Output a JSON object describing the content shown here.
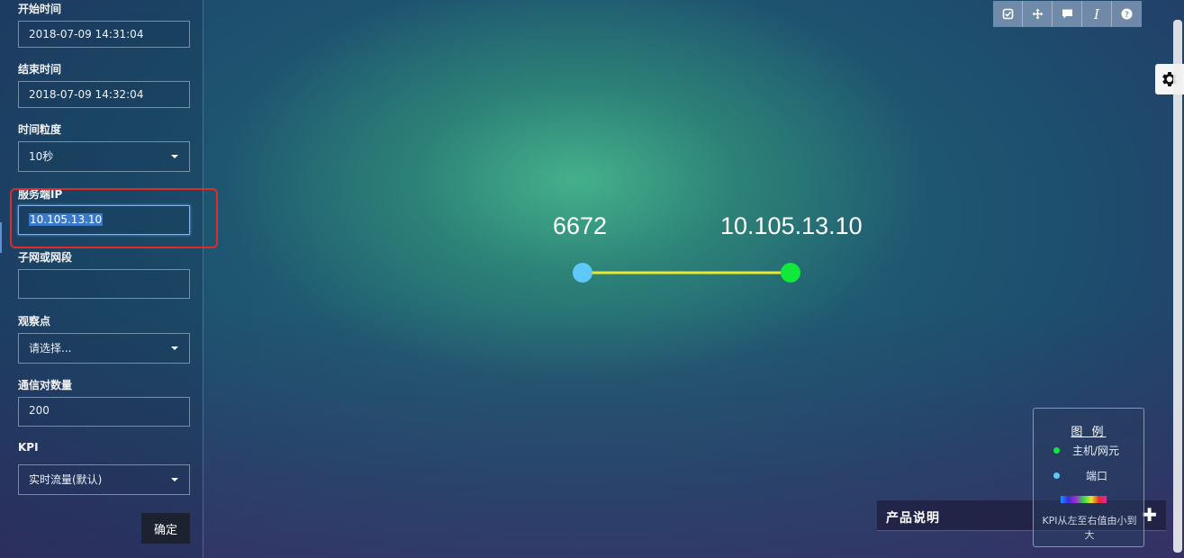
{
  "form": {
    "start_time_label": "开始时间",
    "start_time_value": "2018-07-09 14:31:04",
    "end_time_label": "结束时间",
    "end_time_value": "2018-07-09 14:32:04",
    "granularity_label": "时间粒度",
    "granularity_value": "10秒",
    "server_ip_label": "服务端IP",
    "server_ip_value": "10.105.13.10",
    "subnet_label": "子网或网段",
    "subnet_value": "",
    "observation_label": "观察点",
    "observation_value": "请选择...",
    "pair_count_label": "通信对数量",
    "pair_count_value": "200",
    "kpi_label": "KPI",
    "kpi_value": "实时流量(默认)",
    "confirm_label": "确定"
  },
  "toolbar": {
    "icons": [
      "check-square-icon",
      "move-icon",
      "comment-icon",
      "italic-icon",
      "question-icon"
    ]
  },
  "graph": {
    "port_node_label": "6672",
    "host_node_label": "10.105.13.10",
    "port_color": "#5ec8f8",
    "host_color": "#10e83a",
    "edge_color": "#e8e830"
  },
  "product": {
    "title": "产品说明"
  },
  "legend": {
    "title": "图 例",
    "host_label": "主机/网元",
    "port_label": "端口",
    "note": "KPI从左至右值由小到大"
  }
}
